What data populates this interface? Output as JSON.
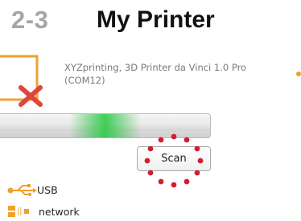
{
  "header": {
    "step": "2-3",
    "title": "My Printer"
  },
  "printer": {
    "name_line1": "XYZprinting, 3D Printer da Vinci 1.0 Pro",
    "name_line2": "(COM12)",
    "status_icon": "printer-disconnected-icon"
  },
  "scan": {
    "label": "Scan",
    "highlight_color": "#d01f2f"
  },
  "connections": {
    "usb_label": "USB",
    "network_label": "network"
  },
  "colors": {
    "accent": "#f0a030",
    "step_gray": "#a6a6a6",
    "progress_green": "#22c03a",
    "error_red": "#e0453c"
  }
}
